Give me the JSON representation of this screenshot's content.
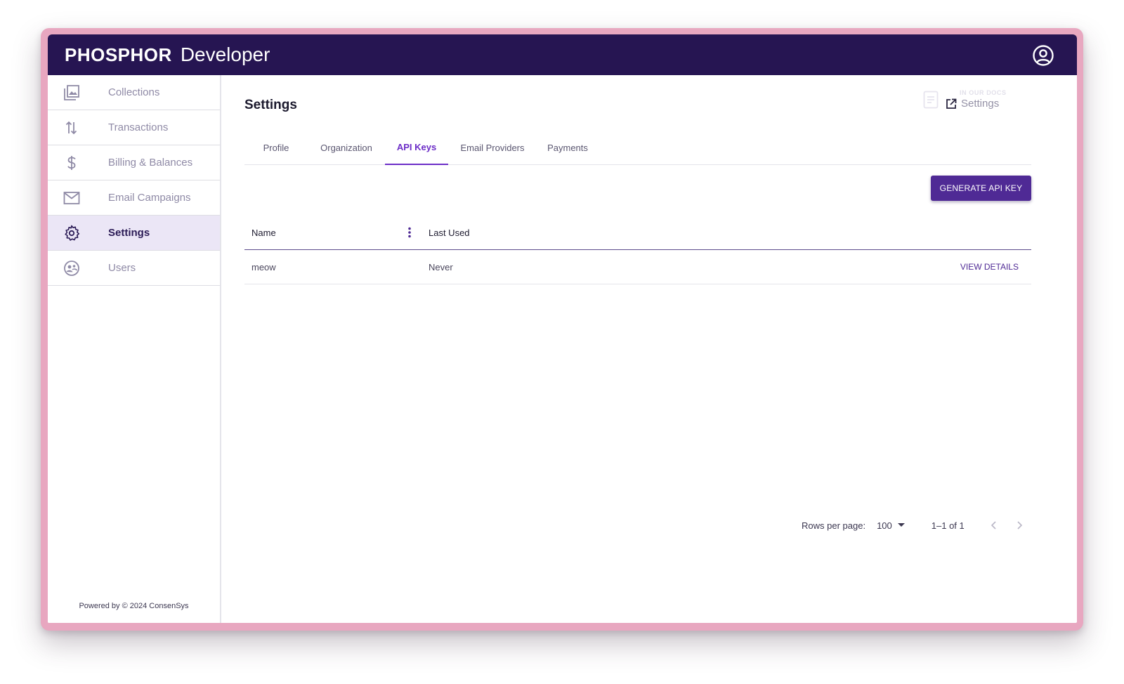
{
  "header": {
    "brand_main": "PHOSPHOR",
    "brand_sub": "Developer",
    "account_icon": "account-circle-icon"
  },
  "sidebar": {
    "items": [
      {
        "label": "Collections",
        "icon": "collections-icon"
      },
      {
        "label": "Transactions",
        "icon": "transfer-arrows-icon"
      },
      {
        "label": "Billing & Balances",
        "icon": "dollar-icon"
      },
      {
        "label": "Email Campaigns",
        "icon": "mail-icon"
      },
      {
        "label": "Settings",
        "icon": "gear-icon",
        "active": true
      },
      {
        "label": "Users",
        "icon": "users-icon"
      }
    ],
    "footer": "Powered by © 2024 ConsenSys"
  },
  "main": {
    "title": "Settings",
    "docs": {
      "eyebrow": "IN OUR DOCS",
      "link_label": "Settings"
    },
    "tabs": [
      {
        "label": "Profile"
      },
      {
        "label": "Organization"
      },
      {
        "label": "API Keys",
        "active": true
      },
      {
        "label": "Email Providers"
      },
      {
        "label": "Payments"
      }
    ],
    "generate_button": "GENERATE API KEY",
    "table": {
      "columns": [
        "Name",
        "Last Used"
      ],
      "rows": [
        {
          "name": "meow",
          "last_used": "Never",
          "action": "VIEW DETAILS"
        }
      ]
    },
    "pagination": {
      "rows_per_page_label": "Rows per page:",
      "rows_per_page_value": "100",
      "range": "1–1 of 1"
    }
  },
  "colors": {
    "header_bg": "#261552",
    "accent": "#6c2dc7",
    "button_bg": "#4f2a95",
    "active_nav_bg": "#ebe6f6",
    "frame": "#e8a7c0"
  }
}
